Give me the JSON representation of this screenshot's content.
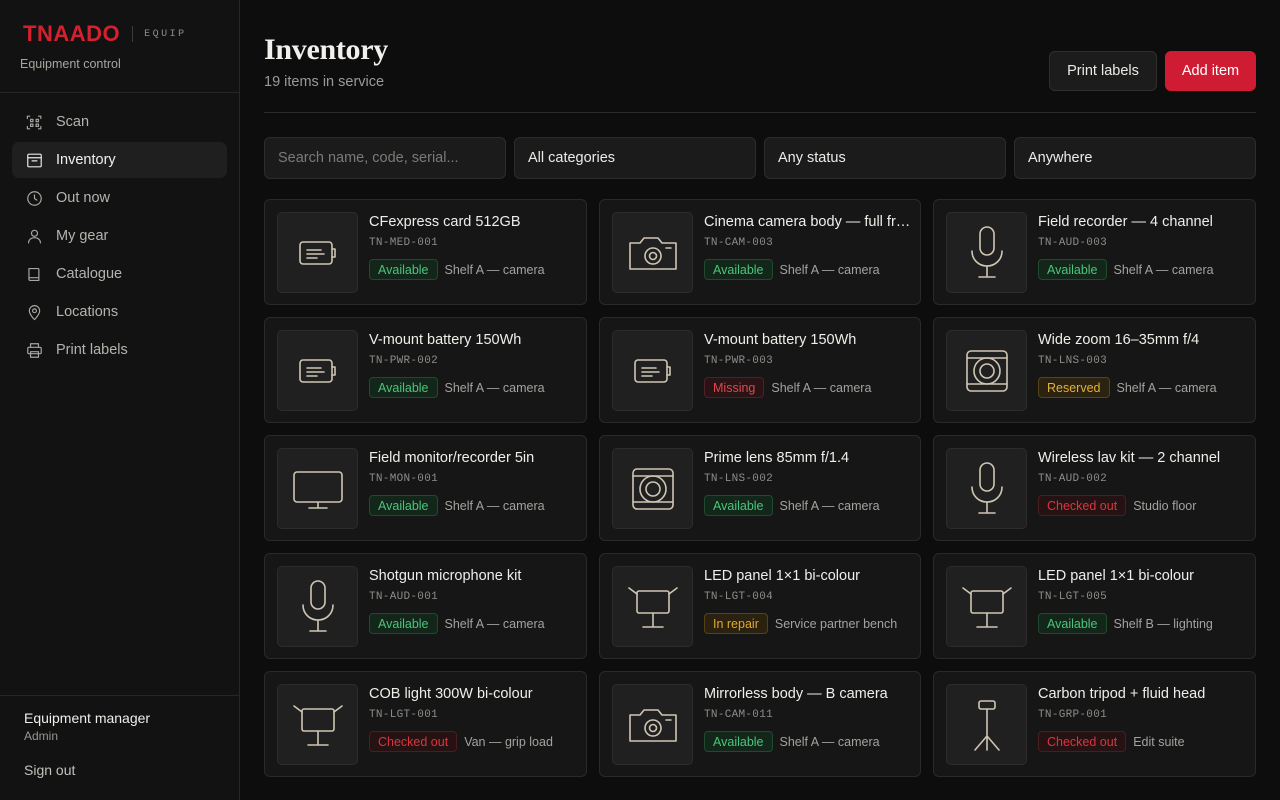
{
  "brand": {
    "logo": "TNAADO",
    "tag": "EQUIP",
    "subtitle": "Equipment control",
    "accent": "#d4202f"
  },
  "nav": [
    {
      "label": "Scan",
      "icon": "scan-icon",
      "active": false
    },
    {
      "label": "Inventory",
      "icon": "inventory-icon",
      "active": true
    },
    {
      "label": "Out now",
      "icon": "clock-icon",
      "active": false
    },
    {
      "label": "My gear",
      "icon": "user-icon",
      "active": false
    },
    {
      "label": "Catalogue",
      "icon": "book-icon",
      "active": false
    },
    {
      "label": "Locations",
      "icon": "location-pin-icon",
      "active": false
    },
    {
      "label": "Print labels",
      "icon": "printer-icon",
      "active": false
    }
  ],
  "user": {
    "name": "Equipment manager",
    "role": "Admin",
    "signout": "Sign out"
  },
  "header": {
    "title": "Inventory",
    "subtitle": "19 items in service",
    "print_label": "Print labels",
    "add_label": "Add item"
  },
  "filters": {
    "search_placeholder": "Search name, code, serial...",
    "category": "All categories",
    "status": "Any status",
    "location": "Anywhere"
  },
  "items": [
    {
      "name": "CFexpress card 512GB",
      "code": "TN-MED-001",
      "status": "Available",
      "status_kind": "available",
      "location": "Shelf A — camera",
      "icon": "battery-icon"
    },
    {
      "name": "Cinema camera body — full frame",
      "code": "TN-CAM-003",
      "status": "Available",
      "status_kind": "available",
      "location": "Shelf A — camera",
      "icon": "camera-icon"
    },
    {
      "name": "Field recorder — 4 channel",
      "code": "TN-AUD-003",
      "status": "Available",
      "status_kind": "available",
      "location": "Shelf A — camera",
      "icon": "microphone-icon"
    },
    {
      "name": "V-mount battery 150Wh",
      "code": "TN-PWR-002",
      "status": "Available",
      "status_kind": "available",
      "location": "Shelf A — camera",
      "icon": "battery-icon"
    },
    {
      "name": "V-mount battery 150Wh",
      "code": "TN-PWR-003",
      "status": "Missing",
      "status_kind": "missing",
      "location": "Shelf A — camera",
      "icon": "battery-icon"
    },
    {
      "name": "Wide zoom 16–35mm f/4",
      "code": "TN-LNS-003",
      "status": "Reserved",
      "status_kind": "reserved",
      "location": "Shelf A — camera",
      "icon": "lens-icon"
    },
    {
      "name": "Field monitor/recorder 5in",
      "code": "TN-MON-001",
      "status": "Available",
      "status_kind": "available",
      "location": "Shelf A — camera",
      "icon": "monitor-icon"
    },
    {
      "name": "Prime lens 85mm f/1.4",
      "code": "TN-LNS-002",
      "status": "Available",
      "status_kind": "available",
      "location": "Shelf A — camera",
      "icon": "lens-icon"
    },
    {
      "name": "Wireless lav kit — 2 channel",
      "code": "TN-AUD-002",
      "status": "Checked out",
      "status_kind": "checked",
      "location": "Studio floor",
      "icon": "microphone-icon"
    },
    {
      "name": "Shotgun microphone kit",
      "code": "TN-AUD-001",
      "status": "Available",
      "status_kind": "available",
      "location": "Shelf A — camera",
      "icon": "microphone-icon"
    },
    {
      "name": "LED panel 1×1 bi-colour",
      "code": "TN-LGT-004",
      "status": "In repair",
      "status_kind": "repair",
      "location": "Service partner bench",
      "icon": "light-panel-icon"
    },
    {
      "name": "LED panel 1×1 bi-colour",
      "code": "TN-LGT-005",
      "status": "Available",
      "status_kind": "available",
      "location": "Shelf B — lighting",
      "icon": "light-panel-icon"
    },
    {
      "name": "COB light 300W bi-colour",
      "code": "TN-LGT-001",
      "status": "Checked out",
      "status_kind": "checked",
      "location": "Van — grip load",
      "icon": "light-panel-icon"
    },
    {
      "name": "Mirrorless body — B camera",
      "code": "TN-CAM-011",
      "status": "Available",
      "status_kind": "available",
      "location": "Shelf A — camera",
      "icon": "camera-icon"
    },
    {
      "name": "Carbon tripod + fluid head",
      "code": "TN-GRP-001",
      "status": "Checked out",
      "status_kind": "checked",
      "location": "Edit suite",
      "icon": "tripod-icon"
    }
  ]
}
